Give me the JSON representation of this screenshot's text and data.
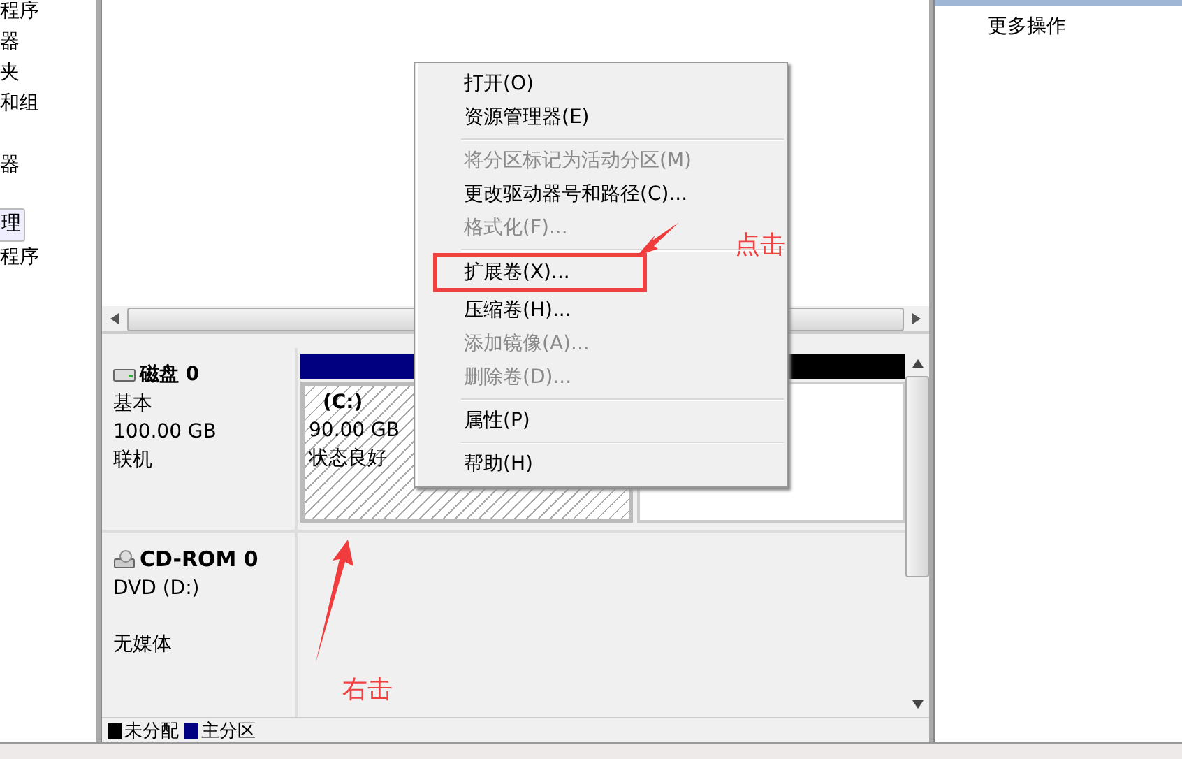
{
  "sidebar": {
    "items": [
      {
        "label": "程序",
        "selected": false
      },
      {
        "label": "器",
        "selected": false
      },
      {
        "label": "夹",
        "selected": false
      },
      {
        "label": "和组",
        "selected": false
      },
      {
        "label": "器",
        "selected": false
      },
      {
        "label": "理",
        "selected": true
      },
      {
        "label": "程序",
        "selected": false
      }
    ]
  },
  "disks": [
    {
      "kind": "disk",
      "name": "磁盘 0",
      "lines": [
        "基本",
        "100.00 GB",
        "联机"
      ],
      "partitions": [
        {
          "kind": "primary",
          "name": "(C:)",
          "lines": [
            "90.00 GB",
            "状态良好"
          ]
        },
        {
          "kind": "unallocated"
        }
      ]
    },
    {
      "kind": "cdrom",
      "name": "CD-ROM 0",
      "lines": [
        "DVD (D:)",
        "无媒体"
      ]
    }
  ],
  "legend": [
    {
      "label": "未分配",
      "color": "#000000"
    },
    {
      "label": "主分区",
      "color": "#000080"
    }
  ],
  "actions_panel": {
    "items": [
      "更多操作"
    ]
  },
  "context_menu": [
    {
      "kind": "item",
      "label": "打开(O)",
      "disabled": false,
      "highlighted": false
    },
    {
      "kind": "item",
      "label": "资源管理器(E)",
      "disabled": false,
      "highlighted": false
    },
    {
      "kind": "separator"
    },
    {
      "kind": "item",
      "label": "将分区标记为活动分区(M)",
      "disabled": true,
      "highlighted": false
    },
    {
      "kind": "item",
      "label": "更改驱动器号和路径(C)...",
      "disabled": false,
      "highlighted": false
    },
    {
      "kind": "item",
      "label": "格式化(F)...",
      "disabled": true,
      "highlighted": false
    },
    {
      "kind": "separator"
    },
    {
      "kind": "item",
      "label": "扩展卷(X)...",
      "disabled": false,
      "highlighted": true
    },
    {
      "kind": "item",
      "label": "压缩卷(H)...",
      "disabled": false,
      "highlighted": false
    },
    {
      "kind": "item",
      "label": "添加镜像(A)...",
      "disabled": true,
      "highlighted": false
    },
    {
      "kind": "item",
      "label": "删除卷(D)...",
      "disabled": true,
      "highlighted": false
    },
    {
      "kind": "separator"
    },
    {
      "kind": "item",
      "label": "属性(P)",
      "disabled": false,
      "highlighted": false
    },
    {
      "kind": "separator"
    },
    {
      "kind": "item",
      "label": "帮助(H)",
      "disabled": false,
      "highlighted": false
    }
  ],
  "annotations": [
    {
      "kind": "menu-note",
      "text": "点击"
    },
    {
      "kind": "disk-note",
      "text": "右击"
    }
  ]
}
